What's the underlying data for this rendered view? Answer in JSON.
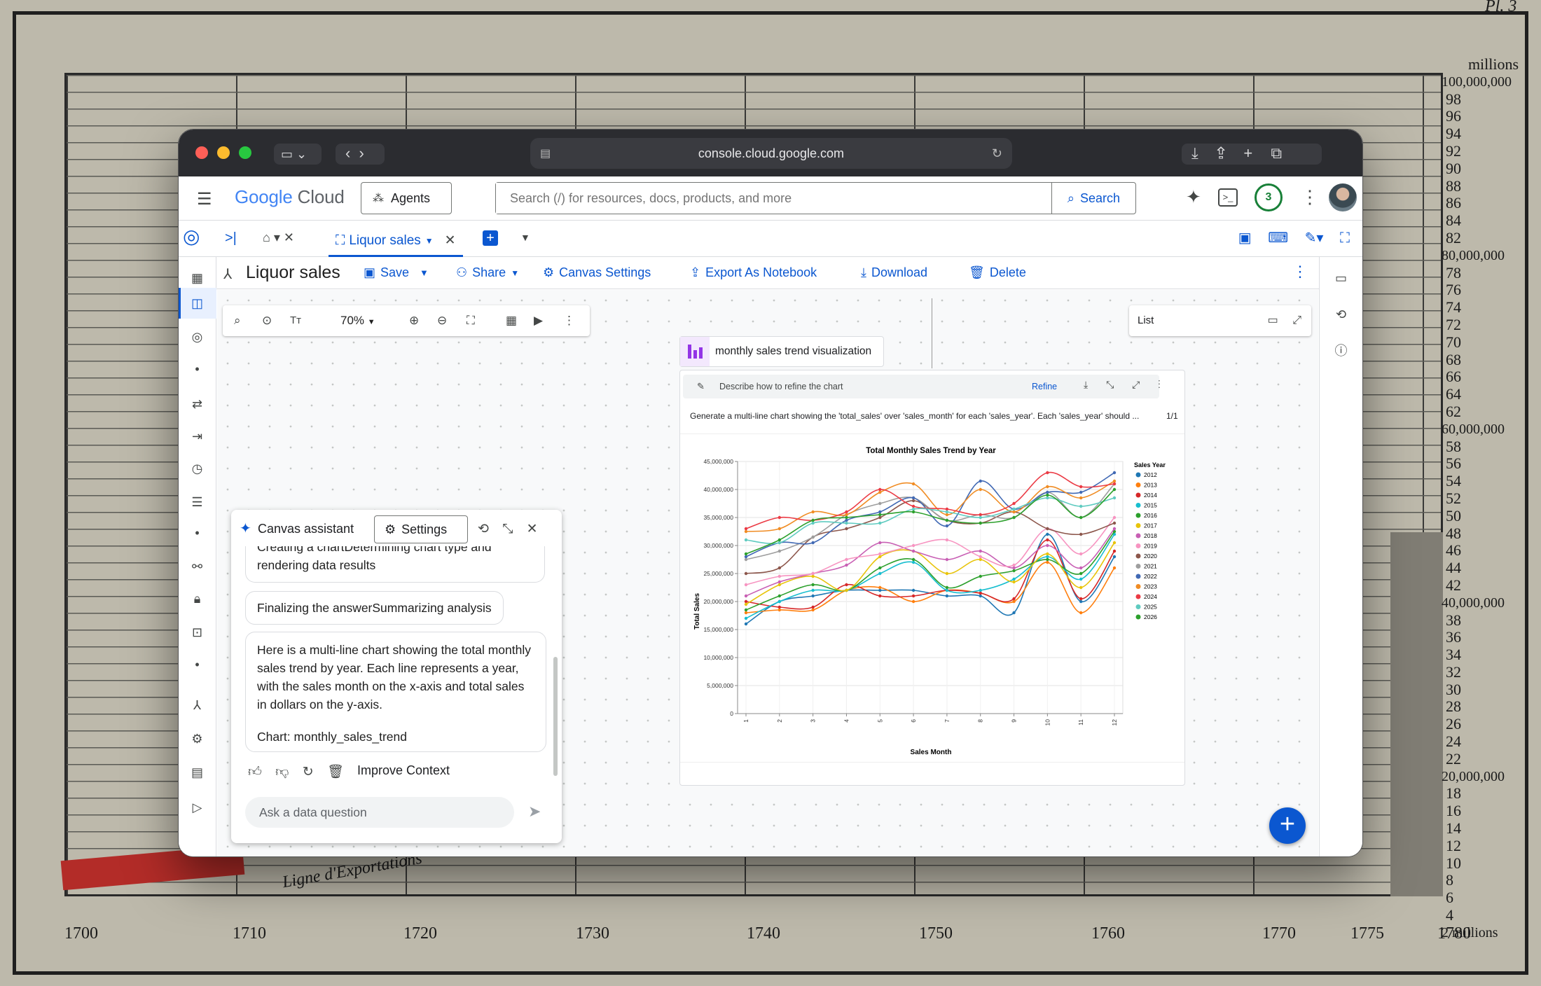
{
  "background": {
    "x_labels": [
      "1700",
      "1710",
      "1720",
      "1730",
      "1740",
      "1750",
      "1760",
      "1770",
      "1775",
      "1780"
    ],
    "plate": "Pl. 3",
    "scale_top": "millions",
    "scale_first": "100,000,000",
    "scale_values": [
      "98",
      "96",
      "94",
      "92",
      "90",
      "88",
      "86",
      "84",
      "82",
      "80,000,000",
      "78",
      "76",
      "74",
      "72",
      "70",
      "68",
      "66",
      "64",
      "62",
      "60,000,000",
      "58",
      "56",
      "54",
      "52",
      "50",
      "48",
      "46",
      "44",
      "42",
      "40,000,000",
      "38",
      "36",
      "34",
      "32",
      "30",
      "28",
      "26",
      "24",
      "22",
      "20,000,000",
      "18",
      "16",
      "14",
      "12",
      "10",
      "8",
      "6",
      "4",
      "2 millions"
    ],
    "label": "Ligne d'Exportations"
  },
  "browser": {
    "url": "console.cloud.google.com"
  },
  "header": {
    "logo_google": "Google",
    "logo_cloud": "Cloud",
    "agents": "Agents",
    "search_placeholder": "Search (/) for resources, docs, products, and more",
    "search_button": "Search",
    "notifications": "3"
  },
  "tabs": {
    "active": "Liquor sales"
  },
  "toolbar": {
    "title": "Liquor sales",
    "save": "Save",
    "share": "Share",
    "canvas_settings": "Canvas Settings",
    "export": "Export As Notebook",
    "download": "Download",
    "delete": "Delete"
  },
  "zoom": {
    "level": "70%"
  },
  "list_panel": {
    "label": "List"
  },
  "node": {
    "title": "monthly sales trend visualization"
  },
  "card": {
    "refine_placeholder": "Describe how to refine the chart",
    "refine_button": "Refine",
    "prompt": "Generate a multi-line chart showing the 'total_sales' over 'sales_month' for each 'sales_year'. Each 'sales_year' should ...",
    "page": "1/1"
  },
  "chart_data": {
    "type": "line",
    "title": "Total Monthly Sales Trend by Year",
    "xlabel": "Sales Month",
    "ylabel": "Total Sales",
    "x": [
      1,
      2,
      3,
      4,
      5,
      6,
      7,
      8,
      9,
      10,
      11,
      12
    ],
    "x_tick_labels": [
      "1",
      "2",
      "3",
      "4",
      "5",
      "6",
      "7",
      "8",
      "9",
      "10",
      "11",
      "12"
    ],
    "ylim": [
      0,
      45000000
    ],
    "y_ticks": [
      0,
      5000000,
      10000000,
      15000000,
      20000000,
      25000000,
      30000000,
      35000000,
      40000000,
      45000000
    ],
    "y_tick_labels": [
      "0",
      "5,000,000",
      "10,000,000",
      "15,000,000",
      "20,000,000",
      "25,000,000",
      "30,000,000",
      "35,000,000",
      "40,000,000",
      "45,000,000"
    ],
    "grid": true,
    "legend_title": "Sales Year",
    "legend_position": "right",
    "series": [
      {
        "name": "2012",
        "color": "#1f77b4",
        "values": [
          16000000,
          20000000,
          21000000,
          22000000,
          22000000,
          22000000,
          21000000,
          21000000,
          18000000,
          32000000,
          20000000,
          28000000
        ]
      },
      {
        "name": "2013",
        "color": "#ff7f0e",
        "values": [
          18000000,
          18500000,
          18500000,
          22000000,
          22500000,
          20000000,
          22000000,
          21500000,
          20000000,
          27000000,
          18000000,
          26000000
        ]
      },
      {
        "name": "2014",
        "color": "#d62728",
        "values": [
          20000000,
          19000000,
          19000000,
          23000000,
          21000000,
          21000000,
          22000000,
          21500000,
          20500000,
          31000000,
          20500000,
          29000000
        ]
      },
      {
        "name": "2015",
        "color": "#17becf",
        "values": [
          17000000,
          20000000,
          22000000,
          22000000,
          25000000,
          27000000,
          22000000,
          22000000,
          24000000,
          28000000,
          24000000,
          32000000
        ]
      },
      {
        "name": "2016",
        "color": "#2ca02c",
        "values": [
          18500000,
          21000000,
          23000000,
          22000000,
          26000000,
          27500000,
          22500000,
          24500000,
          25500000,
          27500000,
          25000000,
          32500000
        ]
      },
      {
        "name": "2017",
        "color": "#e8c40a",
        "values": [
          19500000,
          23000000,
          24500000,
          22000000,
          28000000,
          29000000,
          25000000,
          27500000,
          23500000,
          28500000,
          22500000,
          30500000
        ]
      },
      {
        "name": "2018",
        "color": "#c85fb4",
        "values": [
          21000000,
          23500000,
          25000000,
          26500000,
          30500000,
          29000000,
          27500000,
          29000000,
          26000000,
          30000000,
          26000000,
          33000000
        ]
      },
      {
        "name": "2019",
        "color": "#f794c1",
        "values": [
          23000000,
          24500000,
          25000000,
          27500000,
          28500000,
          30000000,
          31000000,
          28000000,
          26500000,
          33000000,
          28500000,
          35000000
        ]
      },
      {
        "name": "2020",
        "color": "#8c564b",
        "values": [
          25000000,
          26000000,
          31500000,
          33000000,
          35000000,
          38000000,
          34500000,
          34000000,
          36000000,
          33000000,
          32000000,
          34000000
        ]
      },
      {
        "name": "2021",
        "color": "#9e9e9e",
        "values": [
          27500000,
          29000000,
          31500000,
          35500000,
          37500000,
          38500000,
          34500000,
          35500000,
          35000000,
          39500000,
          35000000,
          41000000
        ]
      },
      {
        "name": "2022",
        "color": "#4169b4",
        "values": [
          28000000,
          30500000,
          30500000,
          34500000,
          36000000,
          38500000,
          33500000,
          41500000,
          36500000,
          39500000,
          39500000,
          43000000
        ]
      },
      {
        "name": "2023",
        "color": "#f08c23",
        "values": [
          32500000,
          33000000,
          36000000,
          35500000,
          39500000,
          41000000,
          35500000,
          40000000,
          36000000,
          40500000,
          38500000,
          41500000
        ]
      },
      {
        "name": "2024",
        "color": "#eb3a44",
        "values": [
          33000000,
          35000000,
          34500000,
          36000000,
          40000000,
          37000000,
          36500000,
          35500000,
          37500000,
          43000000,
          40500000,
          41000000
        ]
      },
      {
        "name": "2025",
        "color": "#5fcbc0",
        "values": [
          31000000,
          30500000,
          34000000,
          34000000,
          34000000,
          36500000,
          36000000,
          35000000,
          36500000,
          38500000,
          37000000,
          38500000
        ]
      },
      {
        "name": "2026",
        "color": "#2ca02c",
        "values": [
          28500000,
          31000000,
          34500000,
          35000000,
          35500000,
          36000000,
          34500000,
          34000000,
          35000000,
          39000000,
          35000000,
          40000000
        ]
      }
    ]
  },
  "assistant": {
    "title": "Canvas assistant",
    "settings": "Settings",
    "msg_cut": "Creating a chartDetermining chart type and",
    "msg_cut2": "rendering data results",
    "msg_final": "Finalizing the answerSummarizing analysis",
    "answer": "Here is a multi-line chart showing the total monthly sales trend by year. Each line represents a year, with the sales month on the x-axis and total sales in dollars on the y-axis.",
    "chart_ref": "Chart: monthly_sales_trend",
    "improve": "Improve Context",
    "input_placeholder": "Ask a data question"
  }
}
